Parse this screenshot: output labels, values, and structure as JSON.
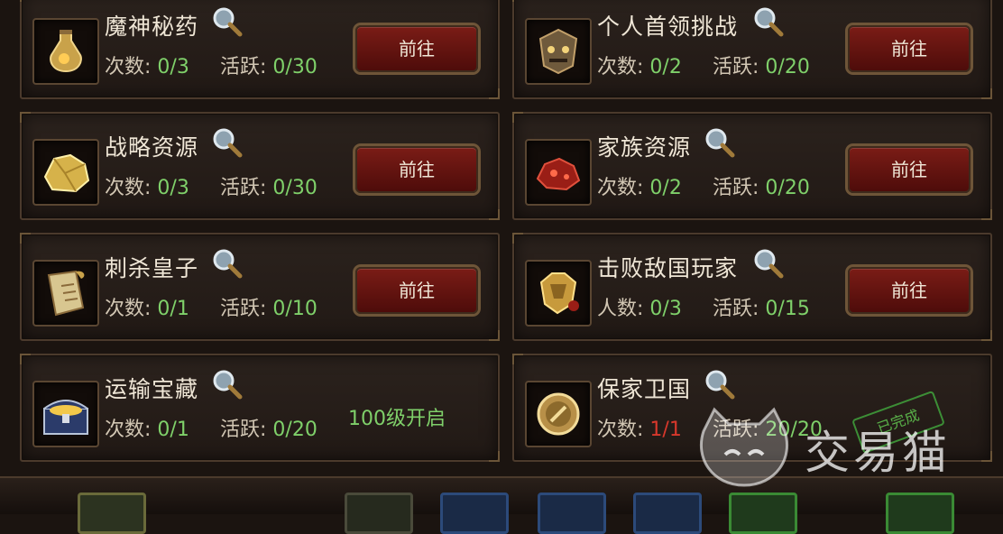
{
  "tasks": [
    {
      "name": "魔神秘药",
      "count_label": "次数:",
      "count_value": "0/3",
      "active_label": "活跃:",
      "active_value": "0/30",
      "button": "前往",
      "icon": "potion-icon"
    },
    {
      "name": "个人首领挑战",
      "count_label": "次数:",
      "count_value": "0/2",
      "active_label": "活跃:",
      "active_value": "0/20",
      "button": "前往",
      "icon": "demon-mask-icon"
    },
    {
      "name": "战略资源",
      "count_label": "次数:",
      "count_value": "0/3",
      "active_label": "活跃:",
      "active_value": "0/30",
      "button": "前往",
      "icon": "gold-ore-icon"
    },
    {
      "name": "家族资源",
      "count_label": "次数:",
      "count_value": "0/2",
      "active_label": "活跃:",
      "active_value": "0/20",
      "button": "前往",
      "icon": "red-ore-icon"
    },
    {
      "name": "刺杀皇子",
      "count_label": "次数:",
      "count_value": "0/1",
      "active_label": "活跃:",
      "active_value": "0/10",
      "button": "前往",
      "icon": "scroll-icon"
    },
    {
      "name": "击败敌国玩家",
      "count_label": "人数:",
      "count_value": "0/3",
      "active_label": "活跃:",
      "active_value": "0/15",
      "button": "前往",
      "icon": "golden-armor-icon"
    },
    {
      "name": "运输宝藏",
      "count_label": "次数:",
      "count_value": "0/1",
      "active_label": "活跃:",
      "active_value": "0/20",
      "unlock_text": "100级开启",
      "icon": "treasure-chest-icon"
    },
    {
      "name": "保家卫国",
      "count_label": "次数:",
      "count_value": "1/1",
      "active_label": "活跃:",
      "active_value": "20/20",
      "stamp": "已完成",
      "icon": "shield-coin-icon"
    }
  ],
  "watermark": "交易猫",
  "colors": {
    "progress": "#7fd06a",
    "complete": "#d8382c",
    "button": "#6e1814"
  }
}
